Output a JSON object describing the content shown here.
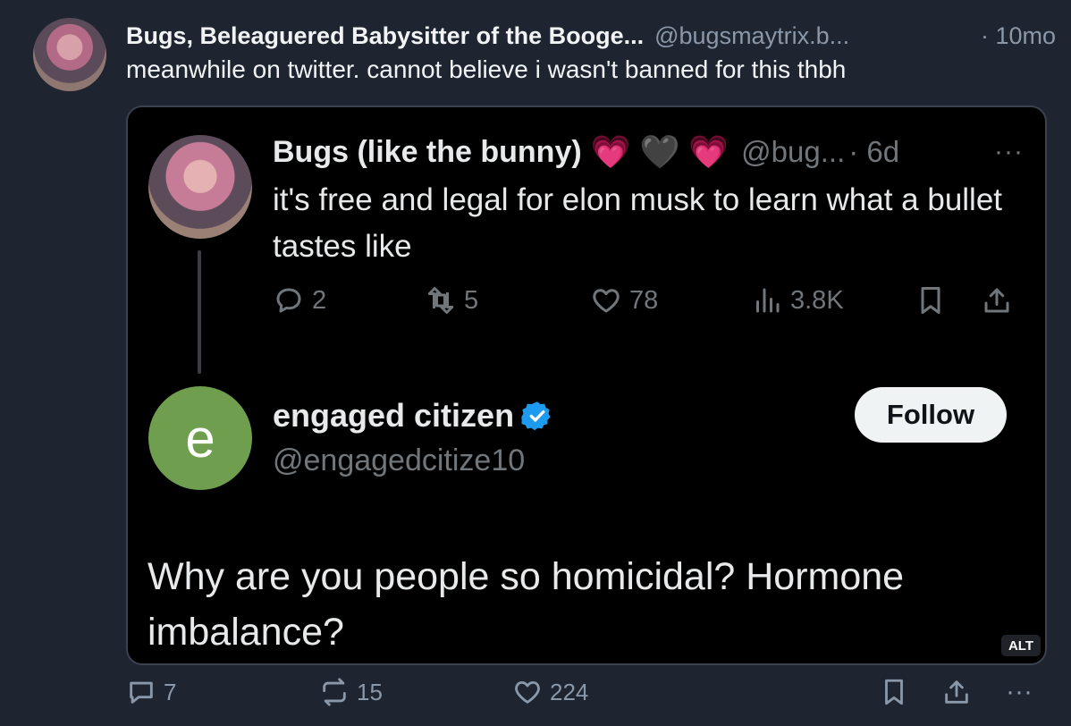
{
  "post": {
    "author_name": "Bugs, Beleaguered Babysitter of the Booge...",
    "handle": "@bugsmaytrix.b...",
    "time": "· 10mo",
    "text": "meanwhile on twitter. cannot believe i wasn't banned for this thbh"
  },
  "embed": {
    "tweet1": {
      "author": "Bugs (like the bunny)",
      "emojis": [
        "💗",
        "🖤",
        "💗"
      ],
      "handle": "@bug...",
      "time": "· 6d",
      "more": "···",
      "text": "it's free and legal for elon musk to learn what a bullet tastes like",
      "replies": "2",
      "retweets": "5",
      "likes": "78",
      "views": "3.8K"
    },
    "tweet2": {
      "avatar_letter": "e",
      "author": "engaged citizen",
      "handle": "@engagedcitize10",
      "follow_label": "Follow",
      "text": "Why are you people so homicidal? Hormone imbalance?"
    },
    "alt_label": "ALT"
  },
  "footer": {
    "replies": "7",
    "reposts": "15",
    "likes": "224",
    "more": "···"
  },
  "colors": {
    "background": "#1e2430",
    "verified": "#1d9bf0",
    "avatar_green": "#6f9e4f"
  }
}
